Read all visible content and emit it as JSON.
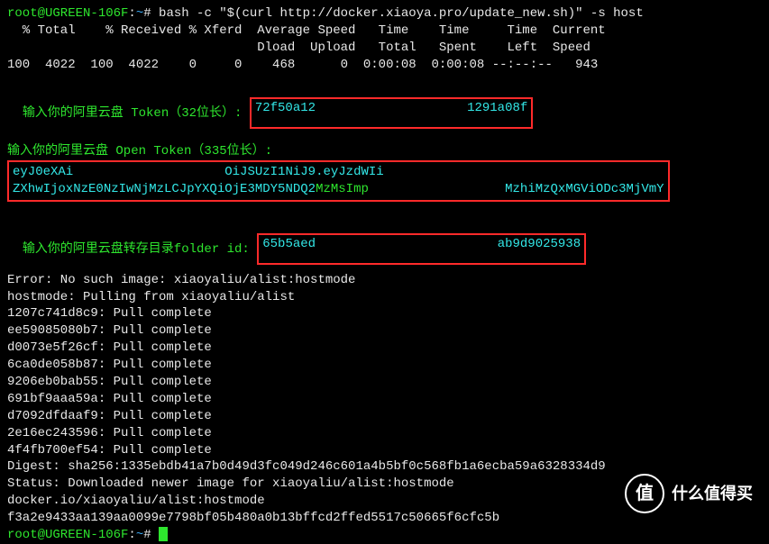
{
  "prompt": {
    "user": "root@UGREEN-106F",
    "path": "~",
    "cmd": "bash -c \"$(curl http://docker.xiaoya.pro/update_new.sh)\" -s host"
  },
  "curl_header": [
    "  % Total    % Received % Xferd  Average Speed   Time    Time     Time  Current",
    "                                 Dload  Upload   Total   Spent    Left  Speed",
    "100  4022  100  4022    0     0    468      0  0:00:08  0:00:08 --:--:--   943"
  ],
  "inputs": {
    "token_label": "输入你的阿里云盘 Token（32位长）: ",
    "token_val_a": "72f50a12",
    "token_val_b": "1291a08f",
    "open_label": "输入你的阿里云盘 Open Token（335位长）: ",
    "open_a": "eyJ0eXAi",
    "open_b": "OiJSUzI1NiJ9.eyJzdWIi",
    "open_c": "ZXhwIjoxNzE0NzIwNjMzLCJpYXQiOjE3MDY5NDQ2",
    "open_d": "MzMsImp",
    "open_e": "MzhiMzQxMGViODc3MjVmY",
    "folder_label": "输入你的阿里云盘转存目录folder id: ",
    "folder_a": "65b5aed",
    "folder_b": "ab9d9025938"
  },
  "pull": {
    "err": "Error: No such image: xiaoyaliu/alist:hostmode",
    "pulling": "hostmode: Pulling from xiaoyaliu/alist",
    "layers": [
      "1207c741d8c9: Pull complete",
      "ee59085080b7: Pull complete",
      "d0073e5f26cf: Pull complete",
      "6ca0de058b87: Pull complete",
      "9206eb0bab55: Pull complete",
      "691bf9aaa59a: Pull complete",
      "d7092dfdaaf9: Pull complete",
      "2e16ec243596: Pull complete",
      "4f4fb700ef54: Pull complete"
    ],
    "digest": "Digest: sha256:1335ebdb41a7b0d49d3fc049d246c601a4b5bf0c568fb1a6ecba59a6328334d9",
    "status": "Status: Downloaded newer image for xiaoyaliu/alist:hostmode",
    "ref": "docker.io/xiaoyaliu/alist:hostmode",
    "container": "f3a2e9433aa139aa0099e7798bf05b480a0b13bffcd2ffed5517c50665f6cfc5b"
  },
  "badge": {
    "icon": "值",
    "text": "什么值得买"
  }
}
